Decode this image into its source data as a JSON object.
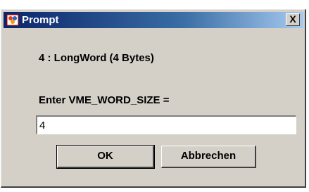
{
  "window": {
    "title": "Prompt",
    "close_label": "X"
  },
  "dialog": {
    "message": "4 : LongWord (4 Bytes)",
    "field_label": "Enter VME_WORD_SIZE =",
    "field_value": "4",
    "ok_label": "OK",
    "cancel_label": "Abbrechen"
  },
  "colors": {
    "titlebar_start": "#0a246a",
    "titlebar_end": "#a6caf0",
    "window_bg": "#d4d0c8"
  },
  "icons": [
    "java-app-icon",
    "close-icon"
  ]
}
